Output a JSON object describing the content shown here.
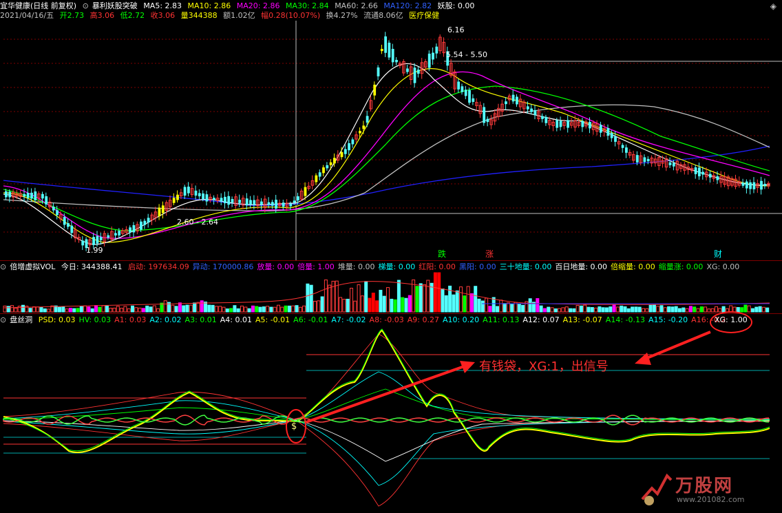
{
  "colors": {
    "up": "#ff3b3b",
    "down": "#54ffff",
    "ma5": "#ffffff",
    "ma10": "#ffff00",
    "ma20": "#ff00ff",
    "ma30": "#00ff00",
    "ma60": "#c0c0c0",
    "ma120": "#0000ff",
    "accent_red": "#ff2020",
    "label_yellow": "#ffff00",
    "label_cyan": "#00ffff",
    "label_green": "#00ff00",
    "label_magenta": "#ff00ff",
    "label_red": "#ff3333",
    "label_blue": "#3060ff"
  },
  "main": {
    "stock_name": "宜华健康(日线 前复权)",
    "indicator_name": "暴利妖股突破",
    "ma5": "MA5: 2.83",
    "ma10": "MA10: 2.86",
    "ma20": "MA20: 2.86",
    "ma30": "MA30: 2.84",
    "ma60": "MA60: 2.66",
    "ma120": "MA120: 2.82",
    "yaogu": "妖股: 0.00",
    "date": "2021/04/16/五",
    "open": "开2.73",
    "high": "高3.06",
    "low": "低2.72",
    "close": "收3.06",
    "volume": "量344388",
    "amount": "额1.02亿",
    "change": "幅0.28(10.07%)",
    "turnover": "换4.27%",
    "float": "流通8.06亿",
    "sector": "医疗保健"
  },
  "vol": {
    "title": "倍增虚拟VOL",
    "today": "今日: 344388.41",
    "items": [
      {
        "t": "启动: 197634.09",
        "c": "#ff3333"
      },
      {
        "t": "异动: 170000.86",
        "c": "#3060ff"
      },
      {
        "t": "放量: 0.00",
        "c": "#ff00ff"
      },
      {
        "t": "倍量: 1.00",
        "c": "#ff00ff"
      },
      {
        "t": "堆量: 0.00",
        "c": "#c0c0c0"
      },
      {
        "t": "梯量: 0.00",
        "c": "#00ffff"
      },
      {
        "t": "红阳: 0.00",
        "c": "#ff3333"
      },
      {
        "t": "黑阳: 0.00",
        "c": "#3060ff"
      },
      {
        "t": "三十地量: 0.00",
        "c": "#00ffff"
      },
      {
        "t": "百日地量: 0.00",
        "c": "#ffffff"
      },
      {
        "t": "倍缩量: 0.00",
        "c": "#ffff00"
      },
      {
        "t": "缩量涨: 0.00",
        "c": "#00ff00"
      },
      {
        "t": "XG: 0.00",
        "c": "#c0c0c0"
      }
    ]
  },
  "psd": {
    "title": "盘丝洞",
    "items": [
      {
        "t": "PSD: 0.03",
        "c": "#ffff00"
      },
      {
        "t": "HV: 0.03",
        "c": "#00ff00"
      },
      {
        "t": "A1: 0.03",
        "c": "#ff3333"
      },
      {
        "t": "A2: 0.02",
        "c": "#00ffff"
      },
      {
        "t": "A3: 0.01",
        "c": "#00ff00"
      },
      {
        "t": "A4: 0.01",
        "c": "#ffffff"
      },
      {
        "t": "A5: -0.01",
        "c": "#ffff00"
      },
      {
        "t": "A6: -0.01",
        "c": "#00ff00"
      },
      {
        "t": "A7: -0.02",
        "c": "#00ffff"
      },
      {
        "t": "A8: -0.03",
        "c": "#ff3333"
      },
      {
        "t": "A9: 0.27",
        "c": "#ff3333"
      },
      {
        "t": "A10: 0.20",
        "c": "#00ffff"
      },
      {
        "t": "A11: 0.13",
        "c": "#00ff00"
      },
      {
        "t": "A12: 0.07",
        "c": "#ffffff"
      },
      {
        "t": "A13: -0.07",
        "c": "#ffff00"
      },
      {
        "t": "A14: -0.13",
        "c": "#00ff00"
      },
      {
        "t": "A15: -0.20",
        "c": "#00ffff"
      },
      {
        "t": "A16: -0.2",
        "c": "#ff3333"
      }
    ],
    "xg": "XG: 1.00"
  },
  "annotations": {
    "signal_text": "有钱袋，XG:1，出信号",
    "marker_die": "跌",
    "marker_zhang": "涨",
    "marker_cai": "财"
  },
  "watermark": {
    "brand": "万股网",
    "url": "www.201082.com"
  },
  "chart_data": [
    {
      "type": "candlestick",
      "title": "暴利妖股突破",
      "price_labels": [
        "6.16",
        "5.54 - 5.50",
        "2.60 - 2.64",
        "1.99"
      ],
      "series": [
        {
          "name": "MA5",
          "value": 2.83
        },
        {
          "name": "MA10",
          "value": 2.86
        },
        {
          "name": "MA20",
          "value": 2.86
        },
        {
          "name": "MA30",
          "value": 2.84
        },
        {
          "name": "MA60",
          "value": 2.66
        },
        {
          "name": "MA120",
          "value": 2.82
        }
      ],
      "ohlc": [
        [
          2.73,
          3.06,
          2.72,
          3.06
        ]
      ],
      "ylim": [
        1.9,
        6.3
      ],
      "points": {
        "high": 6.16,
        "low": 1.99,
        "resistance": "5.54 - 5.50",
        "support": "2.60 - 2.64"
      }
    },
    {
      "type": "bar",
      "title": "倍增虚拟VOL",
      "values": [
        344388.41
      ]
    },
    {
      "type": "line",
      "title": "盘丝洞",
      "series": [
        {
          "name": "PSD",
          "values": [
            0.03
          ]
        },
        {
          "name": "HV",
          "values": [
            0.03
          ]
        },
        {
          "name": "XG",
          "values": [
            1.0
          ]
        }
      ]
    }
  ]
}
